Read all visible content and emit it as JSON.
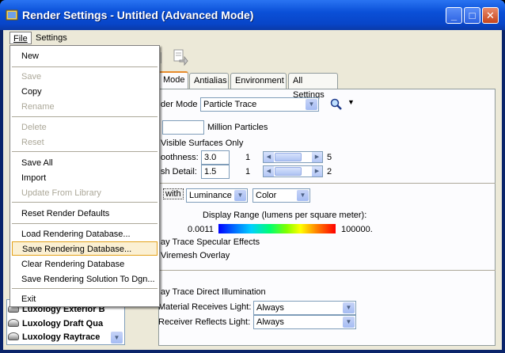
{
  "window": {
    "title": "Render Settings - Untitled (Advanced Mode)",
    "minimize": "_",
    "maximize": "□",
    "close": "✕"
  },
  "menubar": {
    "file": "File",
    "settings": "Settings"
  },
  "tabs": [
    "Mode",
    "Antialias",
    "Environment",
    "All Settings"
  ],
  "render": {
    "mode_label": "der Mode",
    "mode_value": "Particle Trace",
    "million_particles": "Million Particles",
    "visible_surfaces": "Visible Surfaces Only",
    "smoothness_label": "oothness:",
    "smoothness_value": "3.0",
    "smoothness_min": "1",
    "smoothness_max": "5",
    "mesh_label": "sh Detail:",
    "mesh_value": "1.5",
    "mesh_min": "1",
    "mesh_max": "2",
    "with_label": "with",
    "luminance": "Luminance",
    "color": "Color",
    "display_range": "Display Range (lumens per square meter):",
    "range_min": "0.0011",
    "range_max": "100000.",
    "ray_specular": "ay Trace Specular Effects",
    "wiremesh": "Viremesh Overlay",
    "ray_direct": "ay Trace Direct Illumination",
    "material_receives": "Material Receives Light:",
    "material_value": "Always",
    "receiver_reflects": "Receiver Reflects Light:",
    "receiver_value": "Always"
  },
  "database_list": [
    "Luxology Exterior B",
    "Luxology Draft Qua",
    "Luxology Raytrace"
  ],
  "file_menu": {
    "new": "New",
    "save": "Save",
    "copy": "Copy",
    "rename": "Rename",
    "delete": "Delete",
    "reset": "Reset",
    "save_all": "Save All",
    "import": "Import",
    "update_from_library": "Update From Library",
    "reset_render_defaults": "Reset Render Defaults",
    "load_rendering_database": "Load Rendering Database...",
    "save_rendering_database": "Save Rendering Database...",
    "clear_rendering_database": "Clear Rendering Database",
    "save_rendering_solution": "Save Rendering Solution To Dgn...",
    "exit": "Exit"
  }
}
